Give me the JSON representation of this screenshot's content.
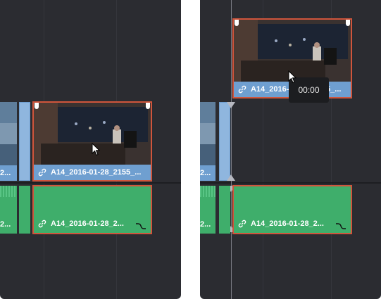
{
  "left_panel": {
    "partial_video_label": "2...",
    "partial_audio_label": "2...",
    "selected_video_clip": {
      "label": "A14_2016-01-28_2155_..."
    },
    "selected_audio_clip": {
      "label": "A14_2016-01-28_2..."
    }
  },
  "right_panel": {
    "partial_video_label": "2...",
    "partial_audio_label": "2...",
    "dragged_video_clip": {
      "label": "A14_2016-01-28_2155_..."
    },
    "audio_clip": {
      "label": "A14_2016-01-28_2..."
    },
    "timecode_tooltip": "00:00"
  },
  "colors": {
    "panel_bg": "#2b2c31",
    "video_clip": "#8fb6de",
    "video_label_bar": "#6f9fd0",
    "audio_clip": "#3fae6b",
    "selection_border": "#d0553c"
  },
  "icons": [
    "link-icon",
    "curve-icon",
    "mouse-cursor-icon",
    "trim-handle-icon"
  ]
}
